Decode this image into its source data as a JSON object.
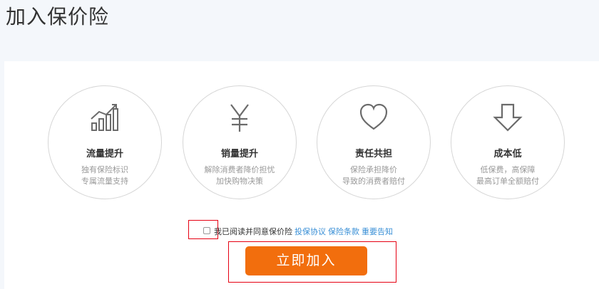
{
  "page_title": "加入保价险",
  "features": [
    {
      "icon": "growth-chart-icon",
      "title": "流量提升",
      "desc": [
        "独有保险标识",
        "专属流量支持"
      ]
    },
    {
      "icon": "yen-icon",
      "title": "销量提升",
      "desc": [
        "解除消费者降价担忧",
        "加快购物决策"
      ]
    },
    {
      "icon": "heart-icon",
      "title": "责任共担",
      "desc": [
        "保险承担降价",
        "导致的消费者赔付"
      ]
    },
    {
      "icon": "down-arrow-icon",
      "title": "成本低",
      "desc": [
        "低保费，高保障",
        "最高订单全额赔付"
      ]
    }
  ],
  "agreement": {
    "text": "我已阅读并同意保价险",
    "links": [
      "投保协议",
      "保险条款",
      "重要告知"
    ]
  },
  "join_button": "立即加入",
  "colors": {
    "accent": "#f26e0d",
    "highlight": "#e60012",
    "link": "#3a8fd6"
  }
}
